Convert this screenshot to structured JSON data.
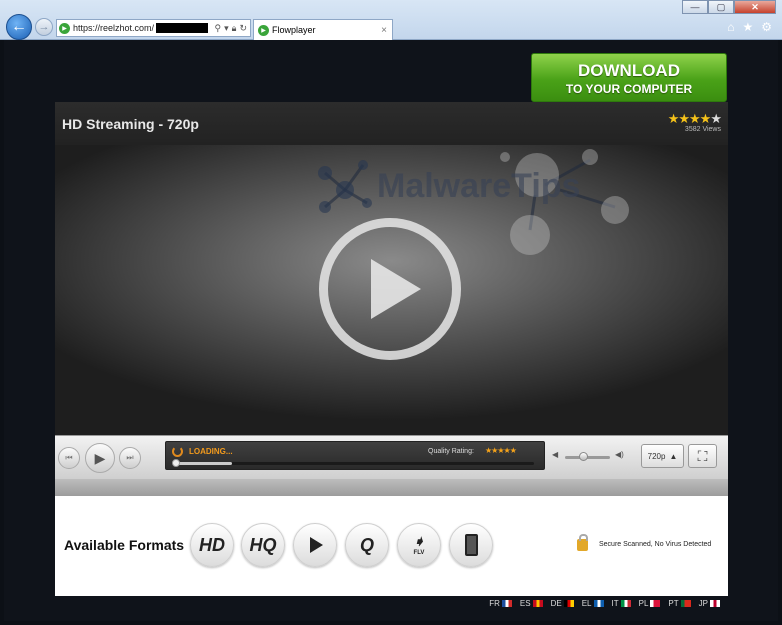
{
  "browser": {
    "address_url": "https://reelzhot.com/",
    "tab_title": "Flowplayer",
    "tab_close": "×",
    "window_buttons": [
      "—",
      "▢",
      "✕"
    ],
    "tools": [
      "home-icon",
      "star-icon",
      "gear-icon"
    ]
  },
  "download": {
    "line1": "DOWNLOAD",
    "line2": "TO YOUR COMPUTER"
  },
  "player": {
    "title": "HD Streaming - 720p",
    "rating_stars": "★★★★",
    "rating_empty": "★",
    "views": "3582 Views",
    "watermark": "MalwareTips",
    "loading": "LOADING...",
    "quality_label": "Quality Rating:",
    "quality_stars": "★★★★★",
    "quality": "720p",
    "progress_fraction": 0.16,
    "volume_fraction": 0.4
  },
  "formats": {
    "label": "Available Formats",
    "items": [
      {
        "name": "hd",
        "text": "HD"
      },
      {
        "name": "hq",
        "text": "HQ"
      },
      {
        "name": "play",
        "text": ""
      },
      {
        "name": "quicktime",
        "text": "Q"
      },
      {
        "name": "flv",
        "text": "FLV"
      },
      {
        "name": "phone",
        "text": ""
      }
    ],
    "secure_text": "Secure Scanned, No Virus Detected"
  },
  "languages": [
    {
      "code": "FR",
      "colors": [
        "#1d4fa0",
        "#ffffff",
        "#d22b2b"
      ]
    },
    {
      "code": "ES",
      "colors": [
        "#c60b1e",
        "#ffc400",
        "#c60b1e"
      ]
    },
    {
      "code": "DE",
      "colors": [
        "#000000",
        "#dd0000",
        "#ffce00"
      ]
    },
    {
      "code": "EL",
      "colors": [
        "#0d5eaf",
        "#ffffff",
        "#0d5eaf"
      ]
    },
    {
      "code": "IT",
      "colors": [
        "#009246",
        "#ffffff",
        "#ce2b37"
      ]
    },
    {
      "code": "PL",
      "colors": [
        "#ffffff",
        "#dc143c",
        "#dc143c"
      ]
    },
    {
      "code": "PT",
      "colors": [
        "#046a38",
        "#da291c",
        "#da291c"
      ]
    },
    {
      "code": "JP",
      "colors": [
        "#ffffff",
        "#bc002d",
        "#ffffff"
      ]
    }
  ]
}
